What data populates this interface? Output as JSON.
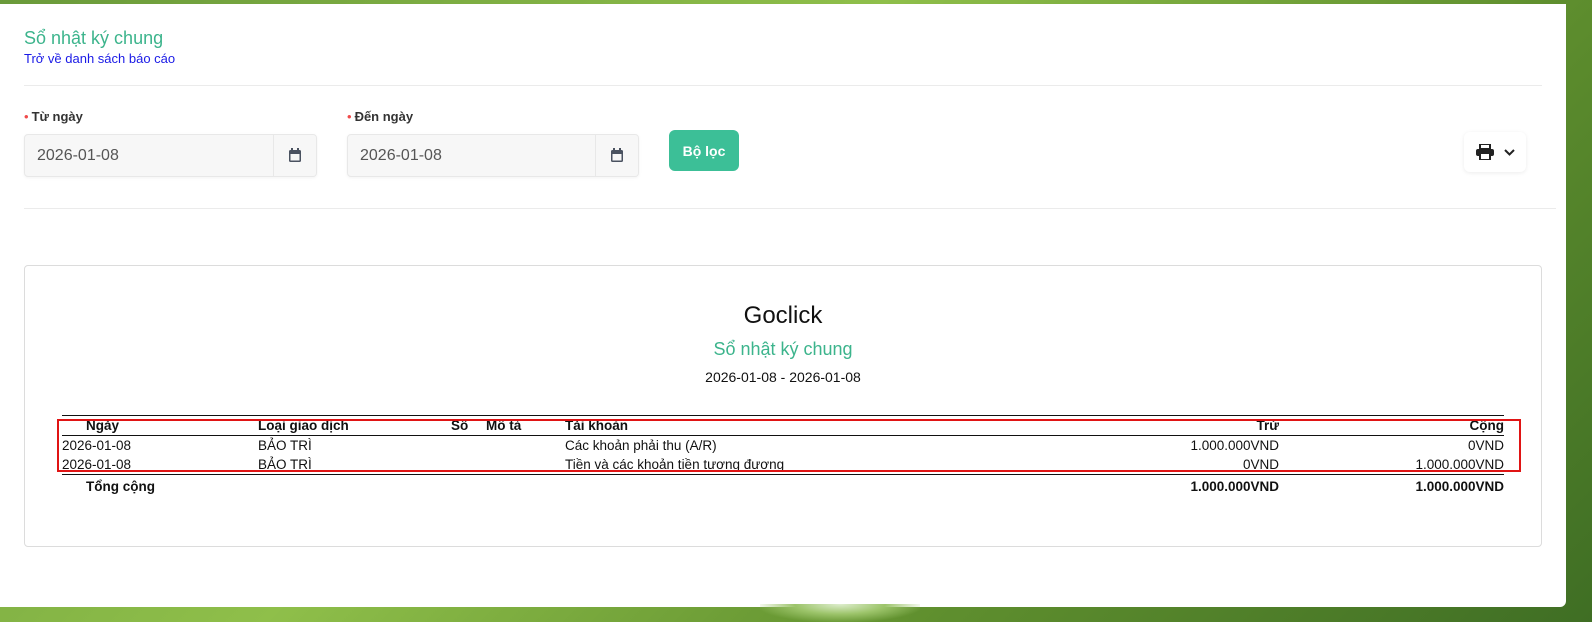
{
  "header": {
    "title": "Sổ nhật ký chung",
    "back_link": "Trở về danh sách báo cáo"
  },
  "filters": {
    "from_label": "Từ ngày",
    "from_value": "2026-01-08",
    "to_label": "Đến ngày",
    "to_value": "2026-01-08",
    "required_mark": "•",
    "filter_button": "Bộ lọc"
  },
  "icons": {
    "calendar": "calendar-icon",
    "print": "printer-icon",
    "dropdown": "chevron-down-icon"
  },
  "report": {
    "company": "Goclick",
    "title": "Sổ nhật ký chung",
    "date_range": "2026-01-08 - 2026-01-08",
    "columns": [
      "Ngày",
      "Loại giao dịch",
      "Số",
      "Mô tả",
      "Tài khoản",
      "Trừ",
      "Cộng"
    ],
    "rows": [
      {
        "date": "2026-01-08",
        "type": "BẢO TRÌ",
        "number": "",
        "description": "",
        "account": "Các khoản phải thu (A/R)",
        "debit": "1.000.000VND",
        "credit": "0VND"
      },
      {
        "date": "2026-01-08",
        "type": "BẢO TRÌ",
        "number": "",
        "description": "",
        "account": "Tiền và các khoản tiền tương đương",
        "debit": "0VND",
        "credit": "1.000.000VND"
      }
    ],
    "total": {
      "label": "Tổng cộng",
      "debit": "1.000.000VND",
      "credit": "1.000.000VND"
    }
  },
  "colors": {
    "accent": "#3cb48c",
    "button": "#3cbf97",
    "link": "#1a1ae6",
    "highlight_box": "#e01414"
  }
}
